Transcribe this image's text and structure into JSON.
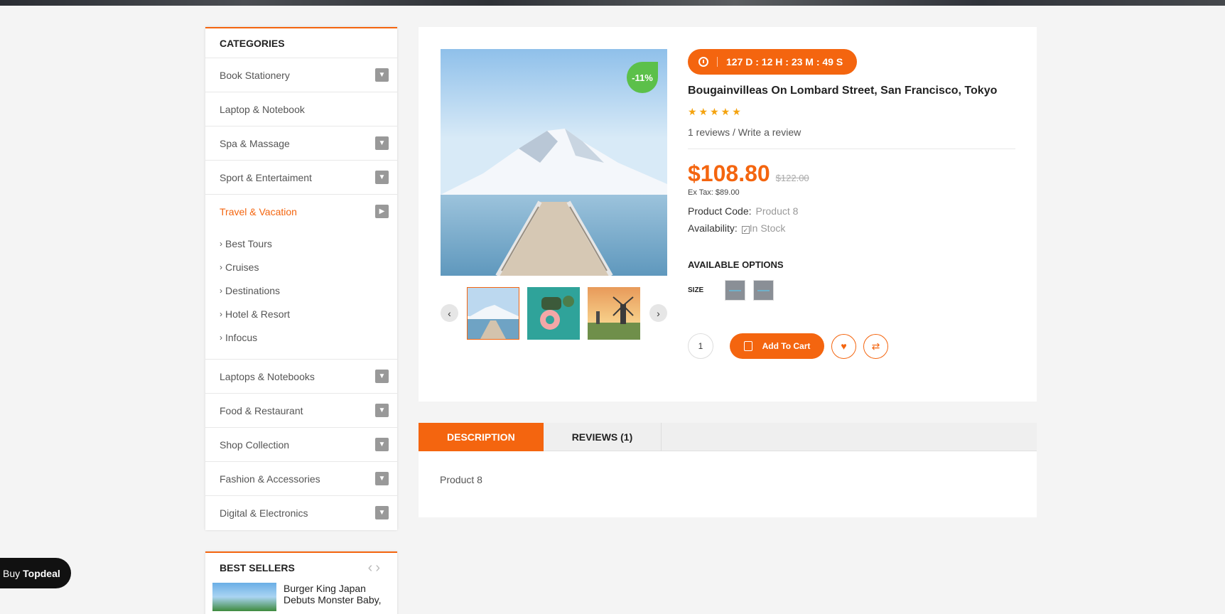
{
  "categories": {
    "title": "CATEGORIES",
    "items": [
      {
        "label": "Book Stationery",
        "has_toggle": true
      },
      {
        "label": "Laptop & Notebook",
        "has_toggle": false
      },
      {
        "label": "Spa & Massage",
        "has_toggle": true
      },
      {
        "label": "Sport & Entertaiment",
        "has_toggle": true
      },
      {
        "label": "Travel & Vacation",
        "has_toggle": true,
        "active": true
      },
      {
        "label": "Laptops & Notebooks",
        "has_toggle": true
      },
      {
        "label": "Food & Restaurant",
        "has_toggle": true
      },
      {
        "label": "Shop Collection",
        "has_toggle": true
      },
      {
        "label": "Fashion & Accessories",
        "has_toggle": true
      },
      {
        "label": "Digital & Electronics",
        "has_toggle": true
      }
    ],
    "sub_items": [
      "Best Tours",
      "Cruises",
      "Destinations",
      "Hotel & Resort",
      "Infocus"
    ]
  },
  "best_sellers": {
    "title": "BEST SELLERS",
    "item_title": "Burger King Japan Debuts Monster Baby,"
  },
  "product": {
    "discount_badge": "-11%",
    "countdown": "127 D : 12 H : 23 M : 49 S",
    "title": "Bougainvilleas On Lombard Street, San Francisco, Tokyo",
    "stars": "★★★★★",
    "reviews_link": "1 reviews / Write a review",
    "price": "$108.80",
    "old_price": "$122.00",
    "ex_tax": "Ex Tax: $89.00",
    "code_label": "Product Code:",
    "code_value": "Product 8",
    "availability_label": "Availability:",
    "availability_value": "In Stock",
    "options_title": "AVAILABLE OPTIONS",
    "size_label": "SIZE",
    "quantity": "1",
    "add_to_cart": "Add To Cart"
  },
  "tabs": {
    "description": "DESCRIPTION",
    "reviews": "REVIEWS (1)",
    "content": "Product 8"
  },
  "buy_badge": {
    "prefix": "Buy",
    "brand": "Topdeal"
  },
  "colors": {
    "accent": "#f4650f",
    "badge_green": "#5cc04a",
    "star": "#f4a30f"
  },
  "icons": {
    "toggle": "chevron-down-icon",
    "toggle_active": "chevron-right-icon",
    "clock": "clock-icon",
    "bag": "shopping-bag-icon",
    "wishlist": "heart-icon",
    "compare": "shuffle-icon"
  }
}
